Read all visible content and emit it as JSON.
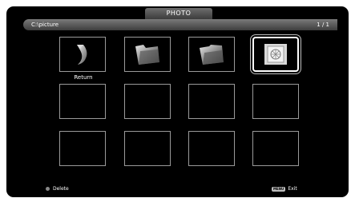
{
  "header": {
    "title": "PHOTO"
  },
  "path_bar": {
    "path": "C:\\picture",
    "page_count": "1 / 1"
  },
  "grid": {
    "items": [
      {
        "kind": "return",
        "label": "Return",
        "icon": "return-arrow-icon"
      },
      {
        "kind": "folder",
        "icon": "folder-icon"
      },
      {
        "kind": "folder",
        "icon": "folder-icon"
      },
      {
        "kind": "file",
        "icon": "photo-file-icon",
        "selected": true
      },
      {
        "kind": "empty"
      },
      {
        "kind": "empty"
      },
      {
        "kind": "empty"
      },
      {
        "kind": "empty"
      },
      {
        "kind": "empty"
      },
      {
        "kind": "empty"
      },
      {
        "kind": "empty"
      },
      {
        "kind": "empty"
      }
    ]
  },
  "footer": {
    "delete_label": "Delete",
    "exit_key": "MENU",
    "exit_label": "Exit"
  }
}
